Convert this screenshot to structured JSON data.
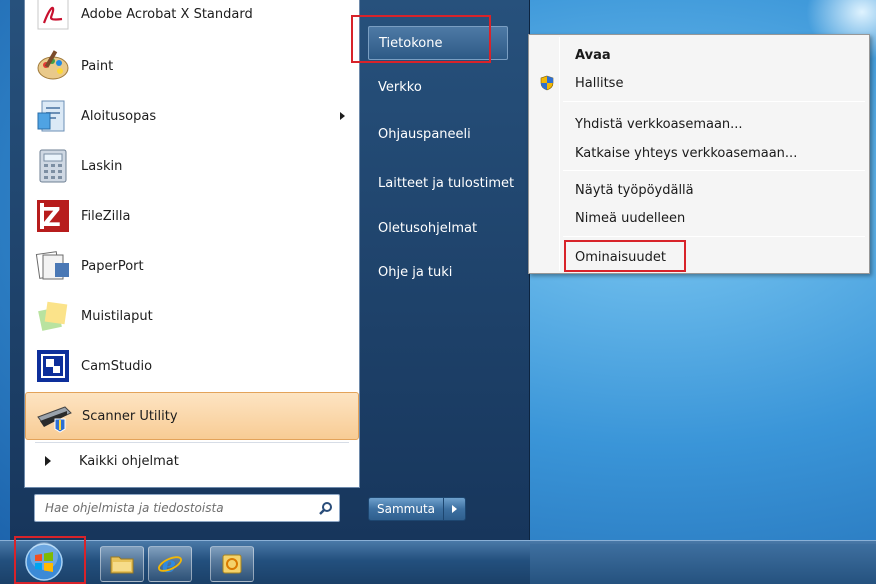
{
  "start_menu": {
    "programs": [
      {
        "label": "Adobe Acrobat X Standard",
        "icon": "acrobat-icon"
      },
      {
        "label": "Paint",
        "icon": "paint-icon"
      },
      {
        "label": "Aloitusopas",
        "icon": "getting-started-icon",
        "has_submenu": true
      },
      {
        "label": "Laskin",
        "icon": "calculator-icon"
      },
      {
        "label": "FileZilla",
        "icon": "filezilla-icon"
      },
      {
        "label": "PaperPort",
        "icon": "paperport-icon"
      },
      {
        "label": "Muistilaput",
        "icon": "sticky-notes-icon"
      },
      {
        "label": "CamStudio",
        "icon": "camstudio-icon"
      },
      {
        "label": "Scanner Utility",
        "icon": "scanner-icon",
        "highlighted": true
      }
    ],
    "all_programs": "Kaikki ohjelmat",
    "search": {
      "placeholder": "Hae ohjelmista ja tiedostoista"
    },
    "right_items": [
      {
        "label": "Tietokone",
        "selected": true
      },
      {
        "label": "Verkko"
      },
      {
        "label": "Ohjauspaneeli"
      },
      {
        "label": "Laitteet ja tulostimet"
      },
      {
        "label": "Oletusohjelmat"
      },
      {
        "label": "Ohje ja tuki"
      }
    ],
    "shutdown_label": "Sammuta"
  },
  "context_menu": {
    "items": [
      {
        "label": "Avaa",
        "bold": true
      },
      {
        "label": "Hallitse",
        "icon": "shield-icon"
      },
      {
        "label": "Yhdistä verkkoasemaan..."
      },
      {
        "label": "Katkaise yhteys verkkoasemaan..."
      },
      {
        "label": "Näytä työpöydällä"
      },
      {
        "label": "Nimeä uudelleen"
      },
      {
        "label": "Ominaisuudet",
        "highlighted": true
      }
    ]
  },
  "taskbar": {
    "buttons": [
      {
        "icon": "windows-explorer-icon"
      },
      {
        "icon": "internet-explorer-icon"
      },
      {
        "icon": "outlook-icon"
      }
    ]
  },
  "colors": {
    "annotation_red": "#d8232a",
    "highlight_orange": "#f8cc95"
  }
}
